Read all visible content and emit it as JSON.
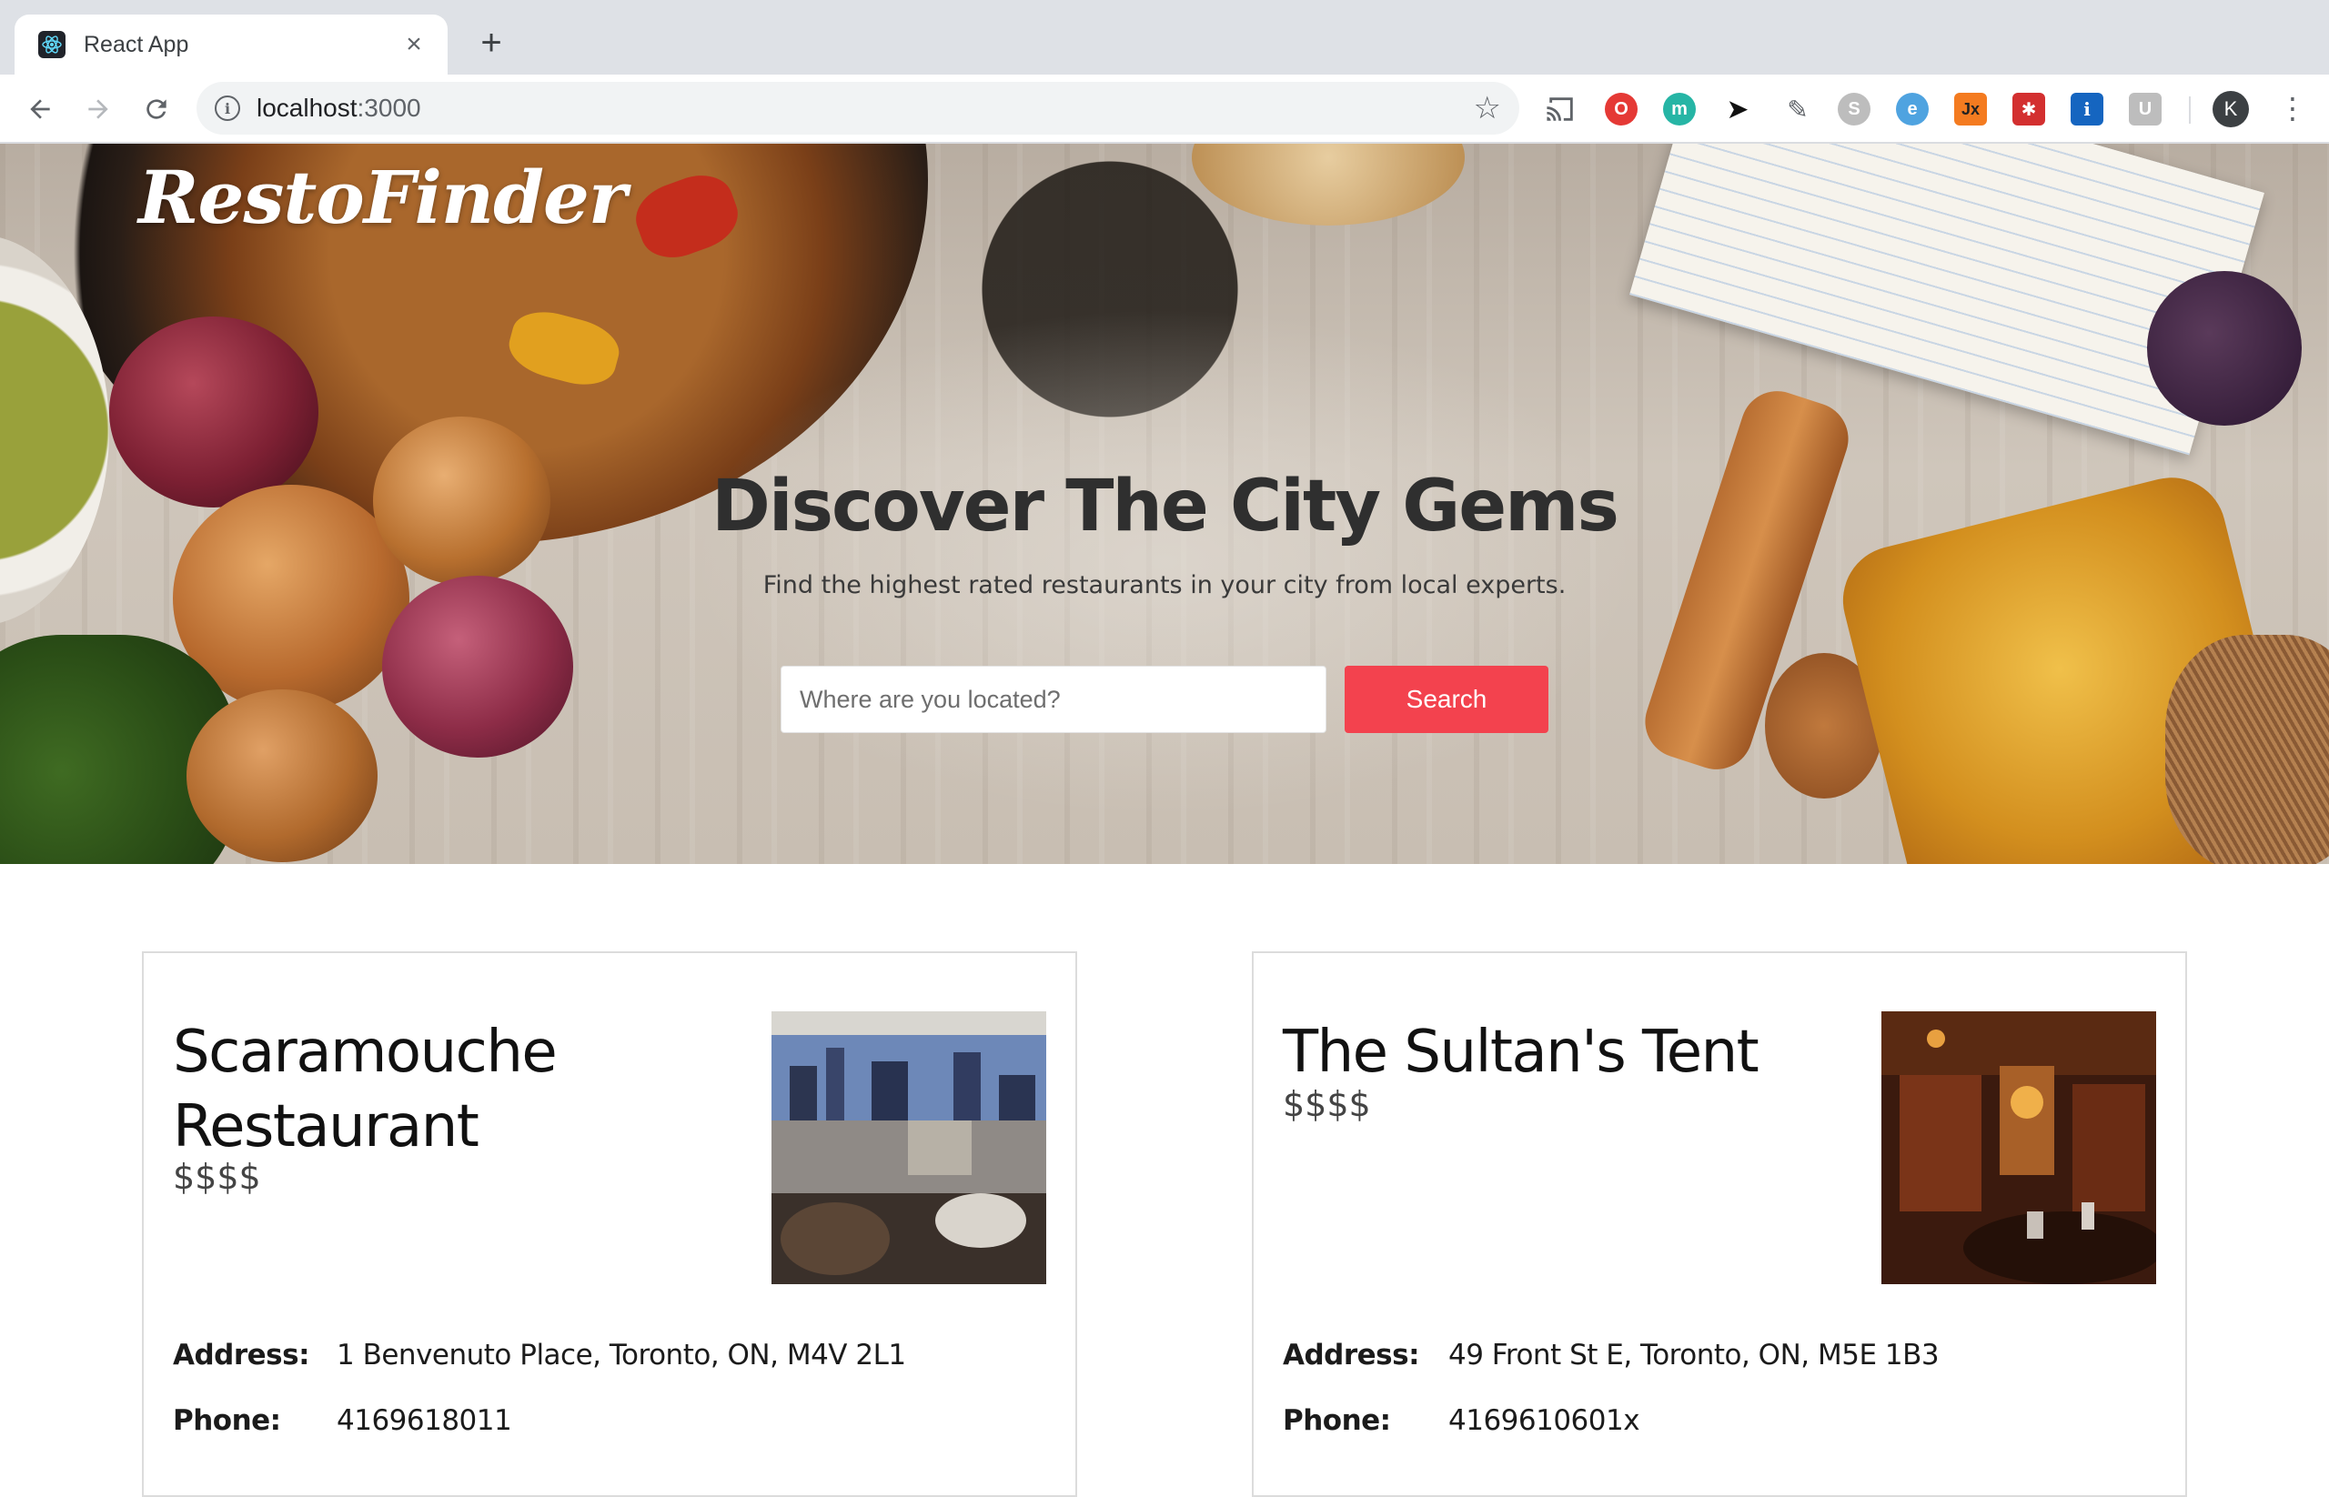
{
  "browser": {
    "tab_title": "React App",
    "tab_close": "×",
    "new_tab": "+",
    "url_host": "localhost",
    "url_port": ":3000",
    "avatar_initial": "K",
    "extensions": [
      {
        "name": "cast-icon",
        "color": "#5f6368"
      },
      {
        "name": "opera-adblock-icon",
        "color": "#e53935"
      },
      {
        "name": "teal-circle-icon",
        "color": "#26b5a5"
      },
      {
        "name": "bird-icon",
        "color": "#111111"
      },
      {
        "name": "eyedropper-icon",
        "color": "#5f6368"
      },
      {
        "name": "skype-icon",
        "color": "#9e9e9e"
      },
      {
        "name": "link-icon",
        "color": "#4fa3e0"
      },
      {
        "name": "jx-icon",
        "color": "#f47b20"
      },
      {
        "name": "bug-icon",
        "color": "#d32f2f"
      },
      {
        "name": "info-icon",
        "color": "#1565c0"
      },
      {
        "name": "u-icon",
        "color": "#9e9e9e"
      }
    ]
  },
  "hero": {
    "logo": "RestoFinder",
    "title": "Discover The City Gems",
    "subtitle": "Find the highest rated restaurants in your city from local experts.",
    "search_placeholder": "Where are you located?",
    "search_button": "Search"
  },
  "restaurants": [
    {
      "name": "Scaramouche Restaurant",
      "price": "$$$$",
      "address_label": "Address:",
      "address": "1 Benvenuto Place, Toronto, ON, M4V 2L1",
      "phone_label": "Phone:",
      "phone": "4169618011"
    },
    {
      "name": "The Sultan's Tent",
      "price": "$$$$",
      "address_label": "Address:",
      "address": "49 Front St E, Toronto, ON, M5E 1B3",
      "phone_label": "Phone:",
      "phone": "4169610601x"
    }
  ],
  "colors": {
    "accent": "#f3424e",
    "chrome_bg": "#dee1e6"
  }
}
